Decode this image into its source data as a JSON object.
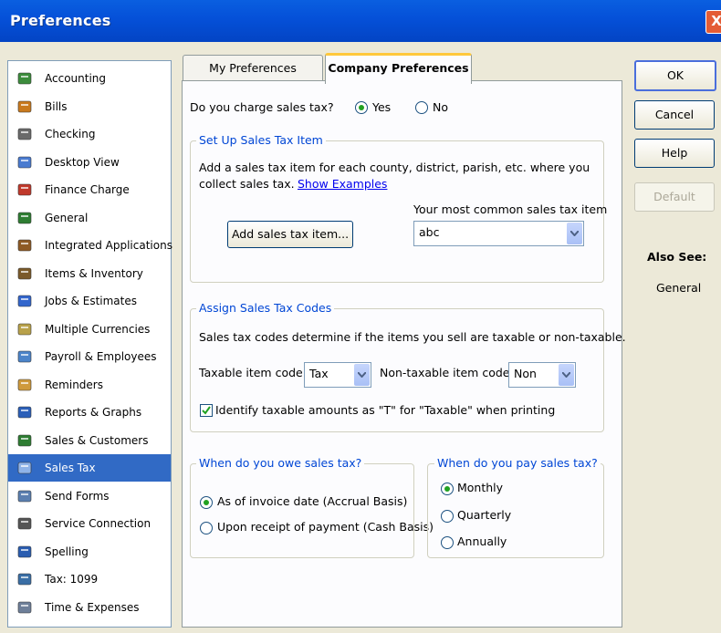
{
  "window": {
    "title": "Preferences",
    "close_glyph": "X"
  },
  "sidebar": {
    "items": [
      {
        "label": "Accounting",
        "icon": "accounting-icon"
      },
      {
        "label": "Bills",
        "icon": "bills-icon"
      },
      {
        "label": "Checking",
        "icon": "checking-icon"
      },
      {
        "label": "Desktop View",
        "icon": "desktop-view-icon"
      },
      {
        "label": "Finance Charge",
        "icon": "finance-charge-icon"
      },
      {
        "label": "General",
        "icon": "general-icon"
      },
      {
        "label": "Integrated Applications",
        "icon": "integrated-applications-icon"
      },
      {
        "label": "Items & Inventory",
        "icon": "items-inventory-icon"
      },
      {
        "label": "Jobs & Estimates",
        "icon": "jobs-estimates-icon"
      },
      {
        "label": "Multiple Currencies",
        "icon": "multiple-currencies-icon"
      },
      {
        "label": "Payroll & Employees",
        "icon": "payroll-employees-icon"
      },
      {
        "label": "Reminders",
        "icon": "reminders-icon"
      },
      {
        "label": "Reports & Graphs",
        "icon": "reports-graphs-icon"
      },
      {
        "label": "Sales & Customers",
        "icon": "sales-customers-icon"
      },
      {
        "label": "Sales Tax",
        "icon": "sales-tax-icon",
        "selected": true
      },
      {
        "label": "Send Forms",
        "icon": "send-forms-icon"
      },
      {
        "label": "Service Connection",
        "icon": "service-connection-icon"
      },
      {
        "label": "Spelling",
        "icon": "spelling-icon"
      },
      {
        "label": "Tax: 1099",
        "icon": "tax-1099-icon"
      },
      {
        "label": "Time & Expenses",
        "icon": "time-expenses-icon"
      }
    ]
  },
  "tabs": {
    "my": "My Preferences",
    "company": "Company Preferences"
  },
  "charge": {
    "question": "Do you charge sales tax?",
    "yes": "Yes",
    "no": "No",
    "selected": "yes"
  },
  "setup": {
    "legend": "Set Up Sales Tax Item",
    "desc1": "Add a sales tax item for each county, district, parish, etc. where you",
    "desc2": "collect sales tax.",
    "show_examples": "Show Examples",
    "common_label": "Your most common sales tax item",
    "add_button": "Add sales tax item...",
    "common_value": "abc"
  },
  "codes": {
    "legend": "Assign Sales Tax Codes",
    "desc": "Sales tax codes determine if the items you sell are taxable or non-taxable.",
    "taxable_label": "Taxable item code",
    "taxable_value": "Tax",
    "nontaxable_label": "Non-taxable item code",
    "nontaxable_value": "Non",
    "identify_label": "Identify taxable amounts as \"T\" for \"Taxable\" when printing",
    "identify_checked": true
  },
  "owe": {
    "legend": "When do you owe sales tax?",
    "accrual": "As of invoice date (Accrual Basis)",
    "cash": "Upon receipt of payment (Cash Basis)",
    "selected": "accrual"
  },
  "pay": {
    "legend": "When do you pay sales tax?",
    "monthly": "Monthly",
    "quarterly": "Quarterly",
    "annually": "Annually",
    "selected": "monthly"
  },
  "buttons": {
    "ok": "OK",
    "cancel": "Cancel",
    "help": "Help",
    "default": "Default"
  },
  "also_see": {
    "title": "Also See:",
    "link": "General"
  }
}
